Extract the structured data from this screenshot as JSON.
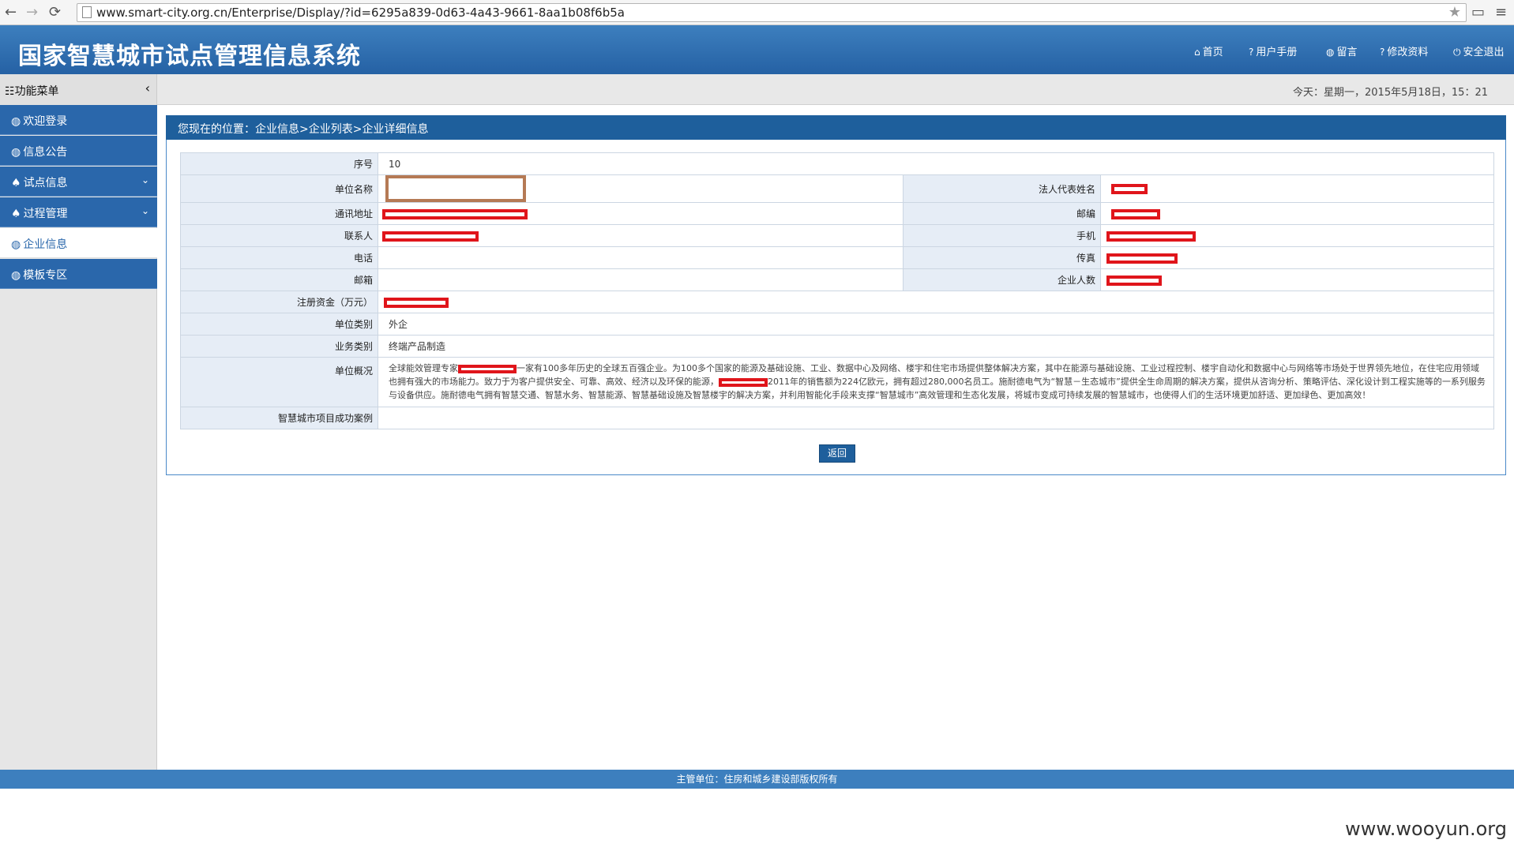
{
  "browser": {
    "url": "www.smart-city.org.cn/Enterprise/Display/?id=6295a839-0d63-4a43-9661-8aa1b08f6b5a",
    "back_icon": "←",
    "forward_icon": "→",
    "reload_icon": "⟳",
    "star_icon": "★",
    "cast_icon": "▭",
    "menu_icon": "≡"
  },
  "header": {
    "title": "国家智慧城市试点管理信息系统",
    "links": [
      {
        "icon": "home-icon",
        "glyph": "⌂",
        "label": "首页"
      },
      {
        "icon": "question-icon",
        "glyph": "?",
        "label": "用户手册"
      },
      {
        "icon": "globe-icon",
        "glyph": "◍",
        "label": "留言"
      },
      {
        "icon": "question-icon",
        "glyph": "?",
        "label": "修改资料"
      },
      {
        "icon": "power-icon",
        "glyph": "⏻",
        "label": "安全退出"
      }
    ]
  },
  "sidebar": {
    "title": "功能菜单",
    "title_icon": "☷",
    "collapse_icon": "‹",
    "items": [
      {
        "label": "欢迎登录",
        "glyph": "◍",
        "chevron": ""
      },
      {
        "label": "信息公告",
        "glyph": "◍",
        "chevron": ""
      },
      {
        "label": "试点信息",
        "glyph": "♠",
        "chevron": "⌄"
      },
      {
        "label": "过程管理",
        "glyph": "♠",
        "chevron": "⌄"
      },
      {
        "label": "企业信息",
        "glyph": "◍",
        "chevron": "",
        "active": true
      },
      {
        "label": "模板专区",
        "glyph": "◍",
        "chevron": ""
      }
    ]
  },
  "status": {
    "date": "今天：星期一，2015年5月18日，15：21"
  },
  "breadcrumb": "您现在的位置：企业信息>企业列表>企业详细信息",
  "details": {
    "seq_label": "序号",
    "seq_value": "10",
    "name_label": "单位名称",
    "legal_label": "法人代表姓名",
    "address_label": "通讯地址",
    "zip_label": "邮编",
    "contact_label": "联系人",
    "mobile_label": "手机",
    "phone_label": "电话",
    "fax_label": "传真",
    "email_label": "邮箱",
    "staff_label": "企业人数",
    "capital_label": "注册资金（万元）",
    "category_label": "单位类别",
    "category_value": "外企",
    "business_label": "业务类别",
    "business_value": "终端产品制造",
    "overview_label": "单位概况",
    "overview_1": "全球能效管理专家",
    "overview_2": "一家有100多年历史的全球五百强企业。为100多个国家的能源及基础设施、工业、数据中心及网络、楼宇和住宅市场提供整体解决方案，其中在能源与基础设施、工业过程控制、楼宇自动化和数据中心与网络等市场处于世界领先地位，在住宅应用领域也拥有强大的市场能力。致力于为客户提供安全、可靠、高效、经济以及环保的能源，",
    "overview_3": "2011年的销售额为224亿欧元，拥有超过280,000名员工。施耐德电气为“智慧－生态城市”提供全生命周期的解决方案，提供从咨询分析、策略评估、深化设计到工程实施等的一系列服务与设备供应。施耐德电气拥有智慧交通、智慧水务、智慧能源、智慧基础设施及智慧楼宇的解决方案，并利用智能化手段来支撑“智慧城市”高效管理和生态化发展，将城市变成可持续发展的智慧城市，也使得人们的生活环境更加舒适、更加绿色、更加高效！",
    "cases_label": "智慧城市项目成功案例"
  },
  "back_button": "返回",
  "footer": "主管单位：住房和城乡建设部版权所有",
  "watermark": "www.wooyun.org"
}
